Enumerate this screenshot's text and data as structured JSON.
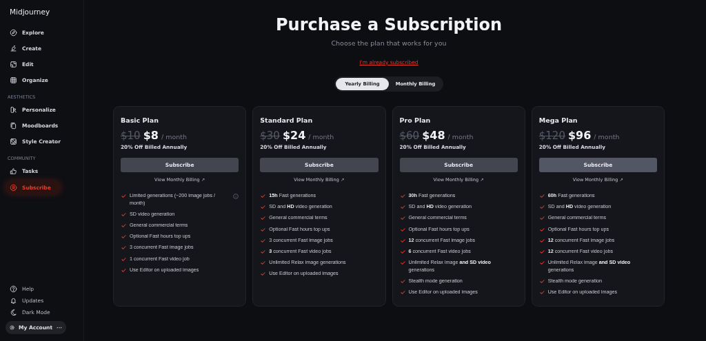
{
  "sidebar": {
    "logo": "Midjourney",
    "sections": [
      {
        "items": [
          {
            "label": "Explore",
            "selected": false
          },
          {
            "label": "Create",
            "selected": false
          },
          {
            "label": "Edit",
            "selected": false
          },
          {
            "label": "Organize",
            "selected": false
          }
        ]
      },
      {
        "heading": "AESTHETICS",
        "items": [
          {
            "label": "Personalize",
            "selected": false
          },
          {
            "label": "Moodboards",
            "selected": false
          },
          {
            "label": "Style Creator",
            "selected": false
          }
        ]
      },
      {
        "heading": "COMMUNITY",
        "items": [
          {
            "label": "Tasks",
            "selected": false
          },
          {
            "label": "Subscribe",
            "selected": true
          }
        ]
      }
    ],
    "bottom_items": [
      {
        "label": "Help"
      },
      {
        "label": "Updates"
      },
      {
        "label": "Dark Mode"
      }
    ],
    "account": {
      "label": "My Account",
      "more": "···"
    }
  },
  "header": {
    "title": "Purchase a Subscription",
    "subtitle": "Choose the plan that works for you",
    "link": "I'm already subscribed"
  },
  "billing_toggle": [
    {
      "label": "Yearly Billing",
      "selected": true
    },
    {
      "label": "Monthly Billing",
      "selected": false
    }
  ],
  "plans": [
    {
      "name": "Basic Plan",
      "old_price": "$10",
      "price": "$8",
      "period": "/ month",
      "discount": "20% Off Billed Annually",
      "button": "Subscribe",
      "highlighted": false,
      "monthly_link": "View Monthly Billing ↗",
      "features": [
        {
          "text": "Limited generations (~200 image jobs / month)",
          "info": true
        },
        {
          "text": "SD video generation",
          "info": false
        },
        {
          "text": "General commercial terms",
          "info": false
        },
        {
          "text": "Optional Fast hours top ups",
          "info": false
        },
        {
          "text": "3 concurrent Fast image jobs",
          "info": false
        },
        {
          "text": "1 concurrent Fast video job",
          "info": false
        },
        {
          "text": "Use Editor on uploaded images",
          "info": false
        }
      ]
    },
    {
      "name": "Standard Plan",
      "old_price": "$30",
      "price": "$24",
      "period": "/ month",
      "discount": "20% Off Billed Annually",
      "button": "Subscribe",
      "highlighted": false,
      "monthly_link": "View Monthly Billing ↗",
      "features": [
        {
          "text": "**15h** Fast generations",
          "info": false
        },
        {
          "text": "SD and **HD** video generation",
          "info": false
        },
        {
          "text": "General commercial terms",
          "info": false
        },
        {
          "text": "Optional Fast hours top ups",
          "info": false
        },
        {
          "text": "3 concurrent Fast image jobs",
          "info": false
        },
        {
          "text": "**3** concurrent Fast video jobs",
          "info": false
        },
        {
          "text": "Unlimited Relax image generations",
          "info": false
        },
        {
          "text": "Use Editor on uploaded images",
          "info": false
        }
      ]
    },
    {
      "name": "Pro Plan",
      "old_price": "$60",
      "price": "$48",
      "period": "/ month",
      "discount": "20% Off Billed Annually",
      "button": "Subscribe",
      "highlighted": false,
      "monthly_link": "View Monthly Billing ↗",
      "features": [
        {
          "text": "**30h** Fast generations",
          "info": false
        },
        {
          "text": "SD and **HD** video generation",
          "info": false
        },
        {
          "text": "General commercial terms",
          "info": false
        },
        {
          "text": "Optional Fast hours top ups",
          "info": false
        },
        {
          "text": "**12** concurrent Fast image jobs",
          "info": false
        },
        {
          "text": "**6** concurrent Fast video jobs",
          "info": false
        },
        {
          "text": "Unlimited Relax image **and SD video** generations",
          "info": false
        },
        {
          "text": "Stealth mode generation",
          "info": false
        },
        {
          "text": "Use Editor on uploaded images",
          "info": false
        }
      ]
    },
    {
      "name": "Mega Plan",
      "old_price": "$120",
      "price": "$96",
      "period": "/ month",
      "discount": "20% Off Billed Annually",
      "button": "Subscribe",
      "highlighted": true,
      "monthly_link": "View Monthly Billing ↗",
      "features": [
        {
          "text": "**60h** Fast generations",
          "info": false
        },
        {
          "text": "SD and **HD** video generation",
          "info": false
        },
        {
          "text": "General commercial terms",
          "info": false
        },
        {
          "text": "Optional Fast hours top ups",
          "info": false
        },
        {
          "text": "**12** concurrent Fast image jobs",
          "info": false
        },
        {
          "text": "**12** concurrent Fast video jobs",
          "info": false
        },
        {
          "text": "Unlimited Relax image **and SD video** generations",
          "info": false
        },
        {
          "text": "Stealth mode generation",
          "info": false
        },
        {
          "text": "Use Editor on uploaded images",
          "info": false
        }
      ]
    }
  ]
}
